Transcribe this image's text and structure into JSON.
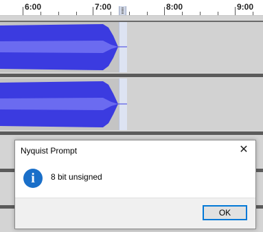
{
  "ruler": {
    "labels": [
      "6:00",
      "7:00",
      "8:00",
      "9:00"
    ]
  },
  "dialog": {
    "title": "Nyquist Prompt",
    "close_glyph": "✕",
    "icon_glyph": "i",
    "icon_name": "info-icon",
    "message": "8 bit unsigned",
    "ok_label": "OK"
  },
  "colors": {
    "wave_outer": "#3b3be0",
    "wave_inner": "#6b6bf0",
    "selection": "#dde3f2",
    "info_blue": "#1a6fc9"
  }
}
